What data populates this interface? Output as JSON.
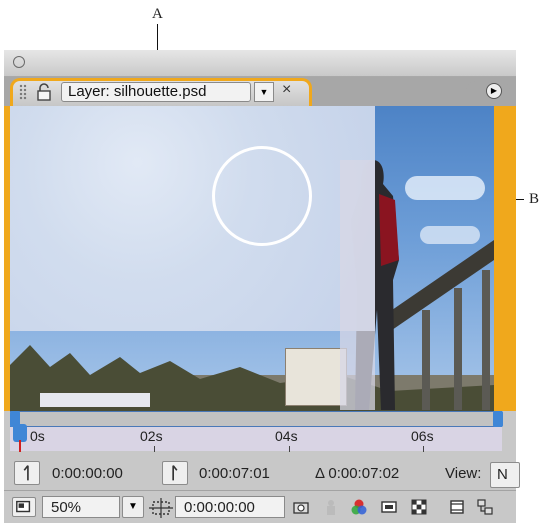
{
  "callouts": {
    "a": "A",
    "b": "B"
  },
  "panel": {
    "layer_label": "Layer: silhouette.psd",
    "close_glyph": "×",
    "dropdown_glyph": "▼",
    "menu_glyph": "▶"
  },
  "timeline": {
    "ticks": [
      "0s",
      "02s",
      "04s",
      "06s"
    ]
  },
  "controls": {
    "in_point": "0:00:00:00",
    "out_point": "0:00:07:01",
    "duration": "Δ 0:00:07:02",
    "view_label": "View:",
    "view_value": "N",
    "zoom": "50%",
    "current_time": "0:00:00:00"
  },
  "colors": {
    "active_panel_border": "#f0a81c",
    "playhead": "#3f86d6"
  }
}
